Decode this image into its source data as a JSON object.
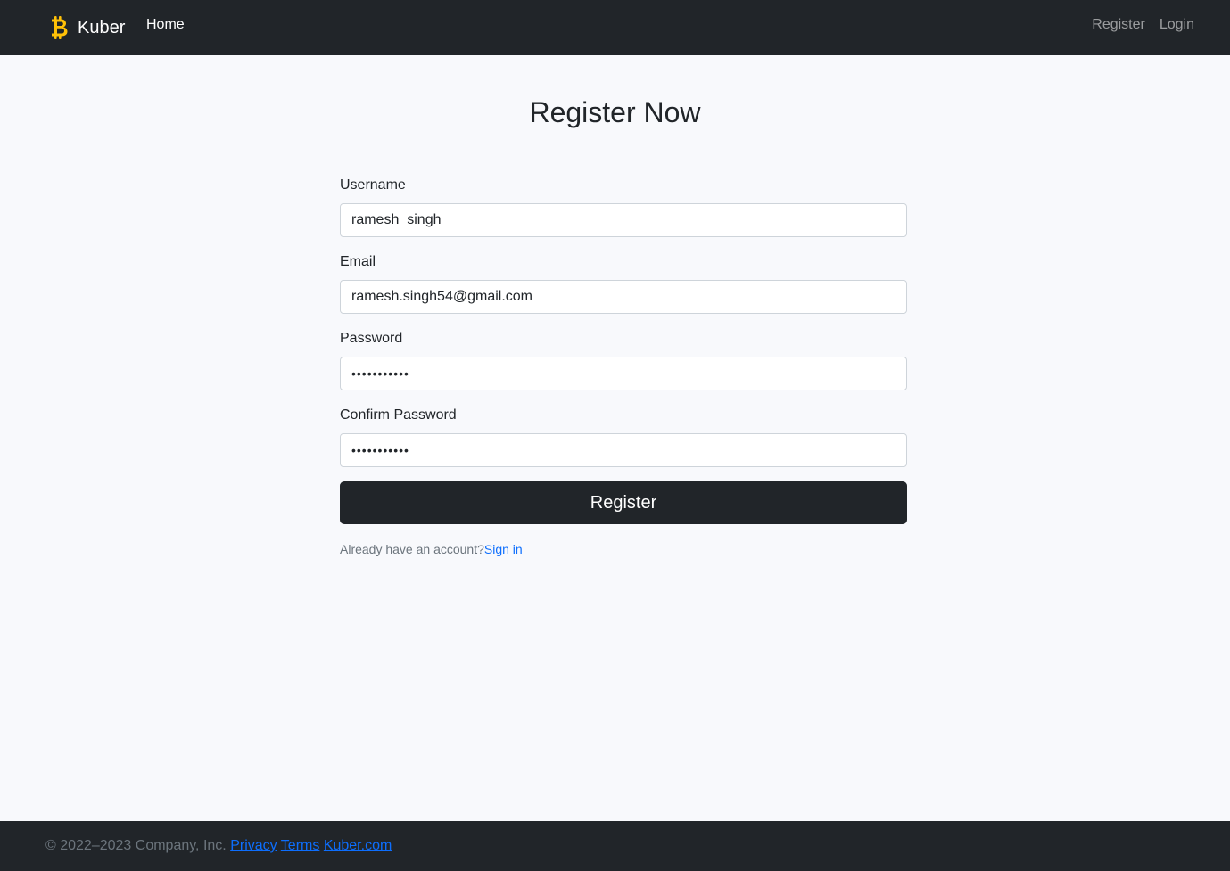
{
  "navbar": {
    "brand_name": "Kuber",
    "brand_icon": "bitcoin-icon",
    "brand_icon_color": "#ffc107",
    "home_label": "Home",
    "register_label": "Register",
    "login_label": "Login"
  },
  "page": {
    "title": "Register Now"
  },
  "form": {
    "username": {
      "label": "Username",
      "value": "ramesh_singh"
    },
    "email": {
      "label": "Email",
      "value": "ramesh.singh54@gmail.com"
    },
    "password": {
      "label": "Password",
      "masked_value": "•••••••••••"
    },
    "confirm_password": {
      "label": "Confirm Password",
      "masked_value": "•••••••••••"
    },
    "submit_label": "Register",
    "signin_prompt": "Already have an account?",
    "signin_link": "Sign in"
  },
  "footer": {
    "copyright": "© 2022–2023 Company, Inc.",
    "links": [
      "Privacy",
      "Terms",
      "Kuber.com"
    ]
  },
  "colors": {
    "dark": "#212529",
    "background": "#f8f9fc",
    "link": "#0d6efd",
    "muted": "#6c757d",
    "brand_accent": "#ffc107"
  }
}
